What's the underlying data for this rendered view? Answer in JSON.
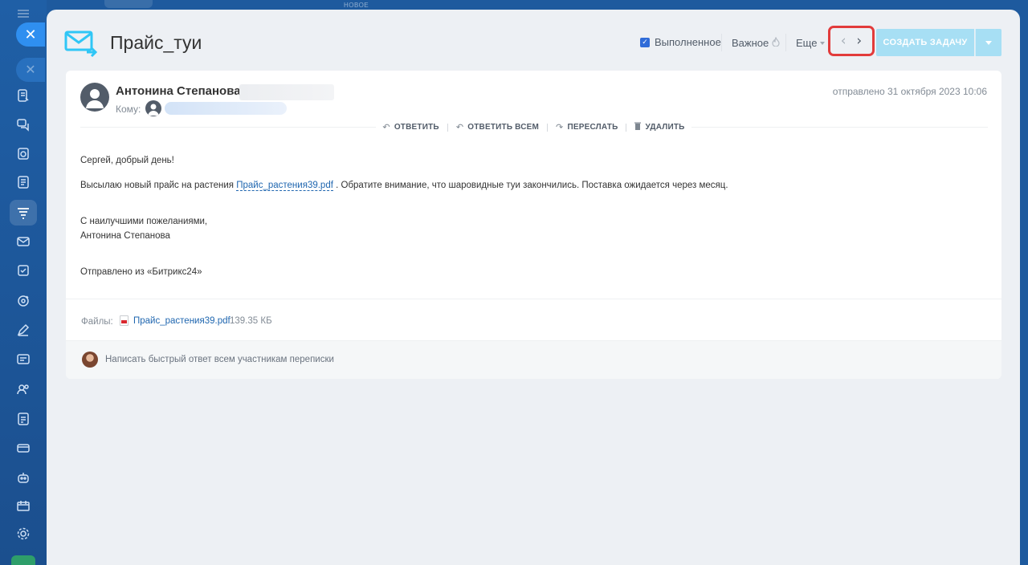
{
  "top_label": "НОВОЕ",
  "window": {
    "title": "Прайс_туи",
    "completed_label": "Выполненное",
    "important_label": "Важное",
    "more_label": "Еще",
    "create_task_label": "СОЗДАТЬ ЗАДАЧУ",
    "nav_prev_glyph": "‹",
    "nav_next_glyph": "›",
    "close_glyph": "✕"
  },
  "email": {
    "sender": "Антонина Степанова",
    "to_label": "Кому:",
    "sent_at": "отправлено 31 октября 2023 10:06",
    "actions": [
      {
        "label": "ОТВЕТИТЬ",
        "icon": "reply-icon",
        "glyph": "↶"
      },
      {
        "label": "ОТВЕТИТЬ ВСЕМ",
        "icon": "reply-all-icon",
        "glyph": "↶"
      },
      {
        "label": "ПЕРЕСЛАТЬ",
        "icon": "forward-icon",
        "glyph": "↷"
      },
      {
        "label": "УДАЛИТЬ",
        "icon": "trash-icon",
        "glyph": "🗑"
      }
    ],
    "body": {
      "greeting": "Сергей, добрый день!",
      "line1_before": "Высылаю новый прайс на растения ",
      "line1_link": "Прайс_растения39.pdf",
      "line1_after": " . Обратите внимание, что шаровидные туи закончились. Поставка ожидается через месяц.",
      "regards": "С наилучшими пожеланиями,",
      "signature": "Антонина Степанова",
      "footer": "Отправлено из «Битрикс24»"
    },
    "files_label": "Файлы:",
    "file_name": "Прайс_растения39.pdf",
    "file_size": "139.35 КБ",
    "quick_reply_placeholder": "Написать быстрый ответ всем участникам переписки"
  },
  "colors": {
    "sidebar": "#1f5fa6",
    "panel_bg": "#edf0f4",
    "accent_button": "#a7dff4",
    "highlight_border": "#e23b3b",
    "link": "#2067b0"
  }
}
